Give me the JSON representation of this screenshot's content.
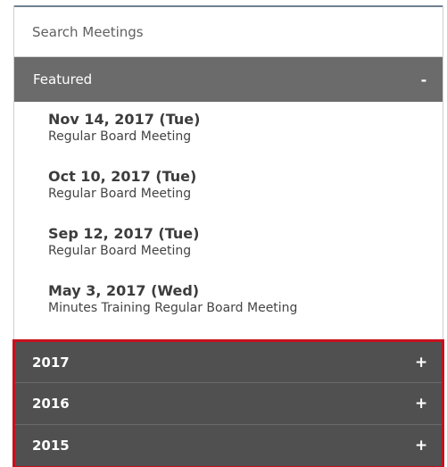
{
  "search": {
    "placeholder": "Search Meetings"
  },
  "featured": {
    "label": "Featured",
    "toggle": "-",
    "meetings": [
      {
        "date": "Nov 14, 2017 (Tue)",
        "title": "Regular Board Meeting"
      },
      {
        "date": "Oct 10, 2017 (Tue)",
        "title": "Regular Board Meeting"
      },
      {
        "date": "Sep 12, 2017 (Tue)",
        "title": "Regular Board Meeting"
      },
      {
        "date": "May 3, 2017 (Wed)",
        "title": "Minutes Training Regular Board Meeting"
      }
    ]
  },
  "years": [
    {
      "label": "2017",
      "toggle": "+"
    },
    {
      "label": "2016",
      "toggle": "+"
    },
    {
      "label": "2015",
      "toggle": "+"
    }
  ],
  "colors": {
    "featured_header": "#6b6b6b",
    "year_row": "#505050",
    "highlight_border": "#c8101e"
  }
}
